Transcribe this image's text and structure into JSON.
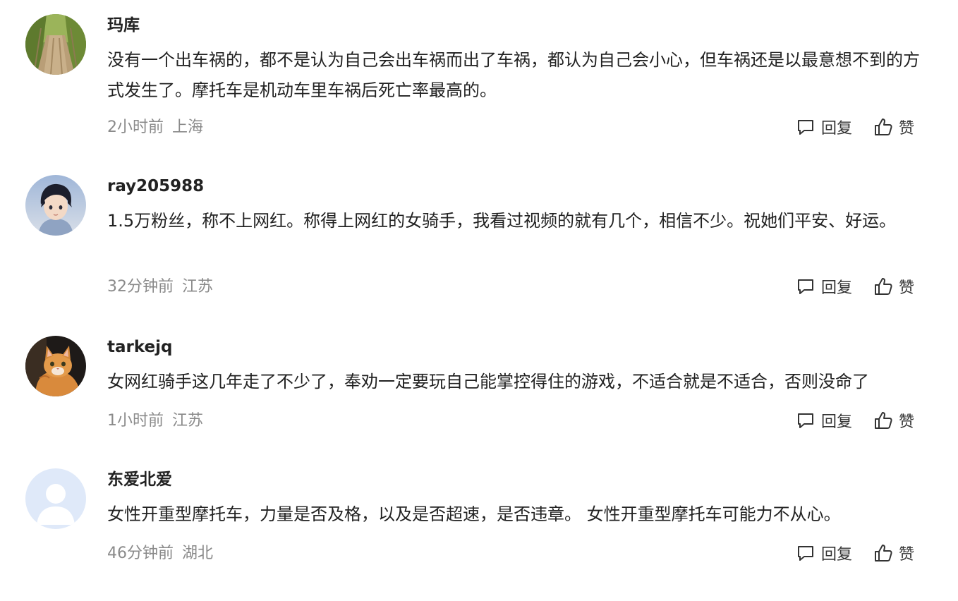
{
  "comments": [
    {
      "username": "玛库",
      "content": "没有一个出车祸的，都不是认为自己会出车祸而出了车祸，都认为自己会小心，但车祸还是以最意想不到的方式发生了。摩托车是机动车里车祸后死亡率最高的。",
      "time": "2小时前",
      "location": "上海",
      "reply_label": "回复",
      "like_label": "赞",
      "avatar": "garden-path-photo"
    },
    {
      "username": "ray205988",
      "content": "1.5万粉丝，称不上网红。称得上网红的女骑手，我看过视频的就有几个，相信不少。祝她们平安、好运。",
      "time": "32分钟前",
      "location": "江苏",
      "reply_label": "回复",
      "like_label": "赞",
      "avatar": "anime-boy-portrait"
    },
    {
      "username": "tarkejq",
      "content": "女网红骑手这几年走了不少了，奉劝一定要玩自己能掌控得住的游戏，不适合就是不适合，否则没命了",
      "time": "1小时前",
      "location": "江苏",
      "reply_label": "回复",
      "like_label": "赞",
      "avatar": "orange-cat-photo"
    },
    {
      "username": "东爱北爱",
      "content": "女性开重型摩托车，力量是否及格，以及是否超速，是否违章。 女性开重型摩托车可能力不从心。",
      "time": "46分钟前",
      "location": "湖北",
      "reply_label": "回复",
      "like_label": "赞",
      "avatar": "default-user-avatar"
    }
  ],
  "colors": {
    "text": "#222222",
    "meta": "#8a8a8a",
    "action": "#333333",
    "background": "#ffffff",
    "default_avatar_bg": "#dfe9f9"
  }
}
